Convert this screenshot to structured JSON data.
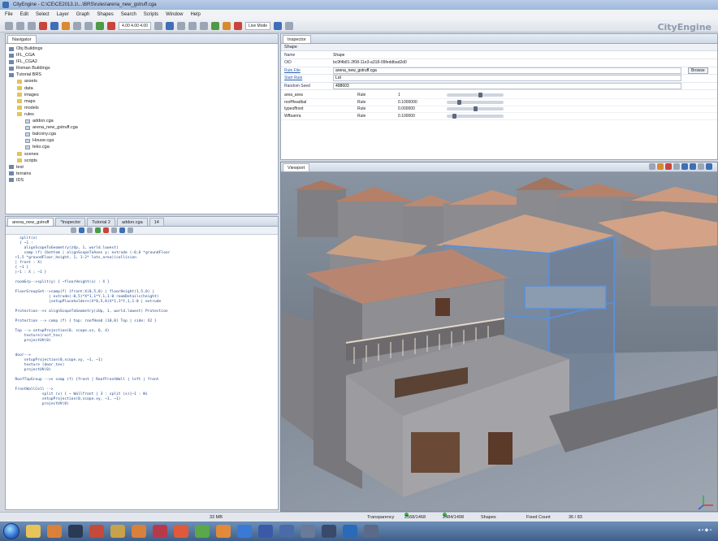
{
  "window": {
    "title": "CityEngine - C:\\CE\\CE2013.1\\...\\BRS\\rules\\arena_new_gstruff.cga"
  },
  "menu": [
    "File",
    "Edit",
    "Select",
    "Layer",
    "Graph",
    "Shapes",
    "Search",
    "Scripts",
    "Window",
    "Help"
  ],
  "toolbar": {
    "coords": "4.00  4.00  4.00",
    "mode_label": "Live Mode",
    "brand": "CityEngine"
  },
  "navigator": {
    "tab": "Navigator",
    "items": [
      {
        "label": "Obj Buildings",
        "type": "proj",
        "indent": 0
      },
      {
        "label": "IFL_CGA",
        "type": "proj",
        "indent": 0
      },
      {
        "label": "IFL_CGA2",
        "type": "proj",
        "indent": 0
      },
      {
        "label": "Roman Buildings",
        "type": "proj",
        "indent": 0
      },
      {
        "label": "Tutorial BRS",
        "type": "proj",
        "indent": 0
      },
      {
        "label": "assets",
        "type": "folder",
        "indent": 1
      },
      {
        "label": "data",
        "type": "folder",
        "indent": 1
      },
      {
        "label": "images",
        "type": "folder",
        "indent": 1
      },
      {
        "label": "maps",
        "type": "folder",
        "indent": 1
      },
      {
        "label": "models",
        "type": "folder",
        "indent": 1
      },
      {
        "label": "rules",
        "type": "folder",
        "indent": 1
      },
      {
        "label": "addon.cga",
        "type": "file",
        "indent": 2
      },
      {
        "label": "arena_new_gstruff.cga",
        "type": "file",
        "indent": 2
      },
      {
        "label": "balcony.cga",
        "type": "file",
        "indent": 2
      },
      {
        "label": "House.cga",
        "type": "file",
        "indent": 2
      },
      {
        "label": "teko.cga",
        "type": "file",
        "indent": 2
      },
      {
        "label": "scenes",
        "type": "folder",
        "indent": 1
      },
      {
        "label": "scripts",
        "type": "folder",
        "indent": 1
      },
      {
        "label": "test",
        "type": "proj",
        "indent": 0
      },
      {
        "label": "terrains",
        "type": "proj",
        "indent": 0
      },
      {
        "label": "IDS",
        "type": "proj",
        "indent": 0
      }
    ]
  },
  "editor": {
    "tabs": [
      "arena_new_gstruff",
      "*Inspector",
      "Tutorial 2",
      "addon.cga",
      "14"
    ],
    "lines": [
      "    split(x)",
      "    { ~1 :",
      "      alignScopeToGeometry(zUp, 1, world.lowest)",
      "      comp (f) {bottom | alignScopeToAxes y; extrude (-0,6 *groundFloor",
      "  +1,5 *groundFloor_height, 1, 1-2* lots_area)(collision",
      "  | front : X)",
      "  { ~1 }",
      "  |~1 : X ; ~1 }",
      "",
      "  roomGrp-->split(y) { ~floorHeight(x) : X }",
      "",
      "  FloorGroupSet-->comp(f) {front:X(0,5,0) | floorHeight(1,5,0) |",
      "                 | extrude(-0,5)*X*1,1*Y,1,1-0 roomDetails(height)",
      "                 |setupPlaceholders(X*0,5,0)X*1,1*Y,1,1-0 | extrude",
      "",
      "  Protection-->s alignScopeToGeometry(zUp, 1, world.lowest) Protection",
      "",
      "  Protection --> comp (f) { top: roofHead (10,0) Top | side: X2 }",
      "",
      "  Top --> setupProjection(0, scope.xz, 6, 4)",
      "      texture(roof_tex)",
      "      projectUV(0)",
      "",
      "",
      "  door-->",
      "      setupProjection(0,scope.xy, ~1, ~1)",
      "      texture (door_tex)",
      "      projectUV(0)",
      "",
      "  RoofTopGroup -->s comp (f) {front | RoofFrontWall | left | front",
      "",
      "  FrontWallCell -->",
      "              split (x) { ~ Wallfront | 3 : split (x){~1 : Wi",
      "              setupProjection(0,scope.xy, ~1, ~1)",
      "              projectUV(0)"
    ]
  },
  "inspector": {
    "tab": "Inspector",
    "section": "Shape",
    "rows": [
      {
        "key": "Name",
        "value": "Shape",
        "kind": "text"
      },
      {
        "key": "OID",
        "value": "bc9f4b81-2f08-11e3-a318-09feddbad2d0",
        "kind": "text"
      },
      {
        "key": "Rule File",
        "value": "arena_new_gstruff.cga",
        "kind": "input",
        "link": true,
        "btn": "Browse"
      },
      {
        "key": "Start Rule",
        "value": "Lot",
        "kind": "input",
        "link": true
      },
      {
        "key": "Random Seed",
        "value": "498603",
        "kind": "input"
      }
    ],
    "attrs": [
      {
        "name": "area_area",
        "source": "Rule",
        "value": "1",
        "level": 0.6
      },
      {
        "name": "roofHeadbal",
        "source": "Rule",
        "value": "0.1000000",
        "level": 0.2
      },
      {
        "name": "typeoffront",
        "source": "Rule",
        "value": "0.000000",
        "level": 0.5
      },
      {
        "name": "Wfbuerra",
        "source": "Rule",
        "value": "0.100000",
        "level": 0.1
      }
    ]
  },
  "viewport": {
    "tab": "Viewport"
  },
  "status": {
    "memory": "33 MB",
    "transparency": "Transparency",
    "p1": "2568/1468",
    "p2": "2484/1498",
    "shapes": "Shapes",
    "fixed": "Fixed Count",
    "fixed_val": "36 / 83"
  },
  "colors": {
    "roof": "#b07a62",
    "wall": "#8f8f93",
    "selection": "#5a8fd6",
    "sky": "#6f7a8a"
  }
}
